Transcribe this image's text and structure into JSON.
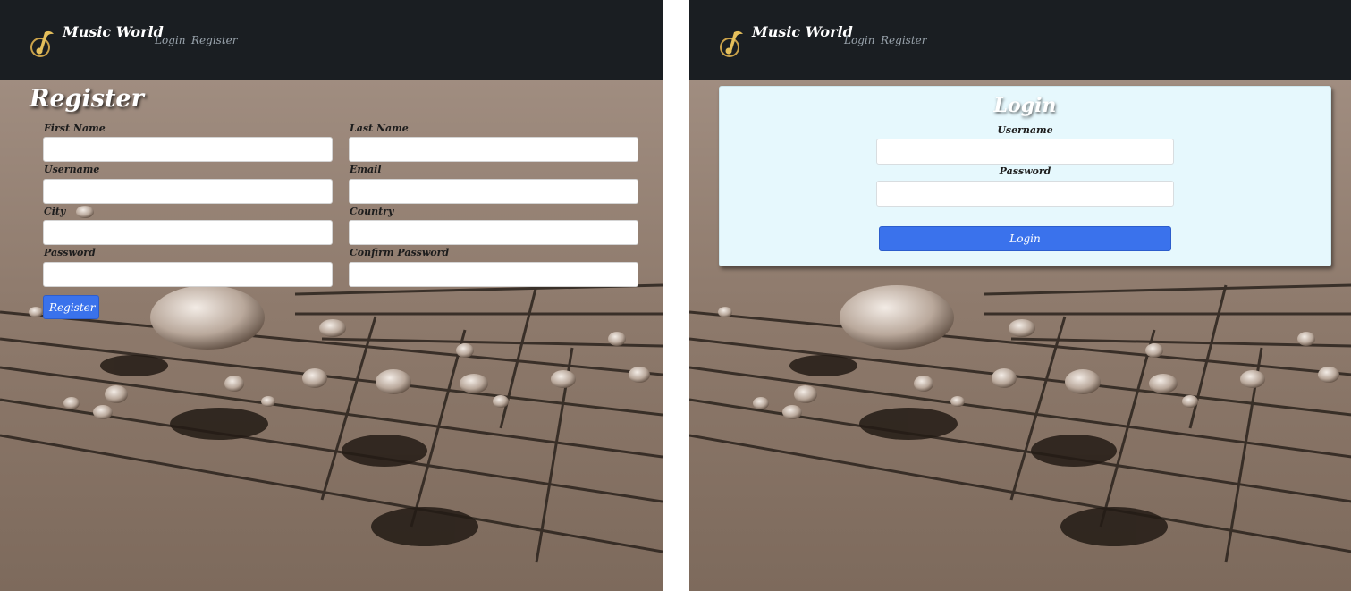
{
  "app": {
    "brand": "Music World",
    "nav": {
      "login_label": "Login",
      "register_label": "Register"
    },
    "icon": "music-note-logo-icon",
    "colors": {
      "navbar": "#1a1e22",
      "accent": "#3a72ec",
      "login_card": "#e6f8fd",
      "background_photo": "#8a7566"
    }
  },
  "register_page": {
    "title": "Register",
    "fields": {
      "first_name": {
        "label": "First Name",
        "value": ""
      },
      "last_name": {
        "label": "Last Name",
        "value": ""
      },
      "username": {
        "label": "Username",
        "value": ""
      },
      "email": {
        "label": "Email",
        "value": ""
      },
      "city": {
        "label": "City",
        "value": ""
      },
      "country": {
        "label": "Country",
        "value": ""
      },
      "password": {
        "label": "Password",
        "value": ""
      },
      "confirm_password": {
        "label": "Confirm Password",
        "value": ""
      }
    },
    "submit_label": "Register"
  },
  "login_page": {
    "title": "Login",
    "fields": {
      "username": {
        "label": "Username",
        "value": ""
      },
      "password": {
        "label": "Password",
        "value": ""
      }
    },
    "submit_label": "Login"
  }
}
